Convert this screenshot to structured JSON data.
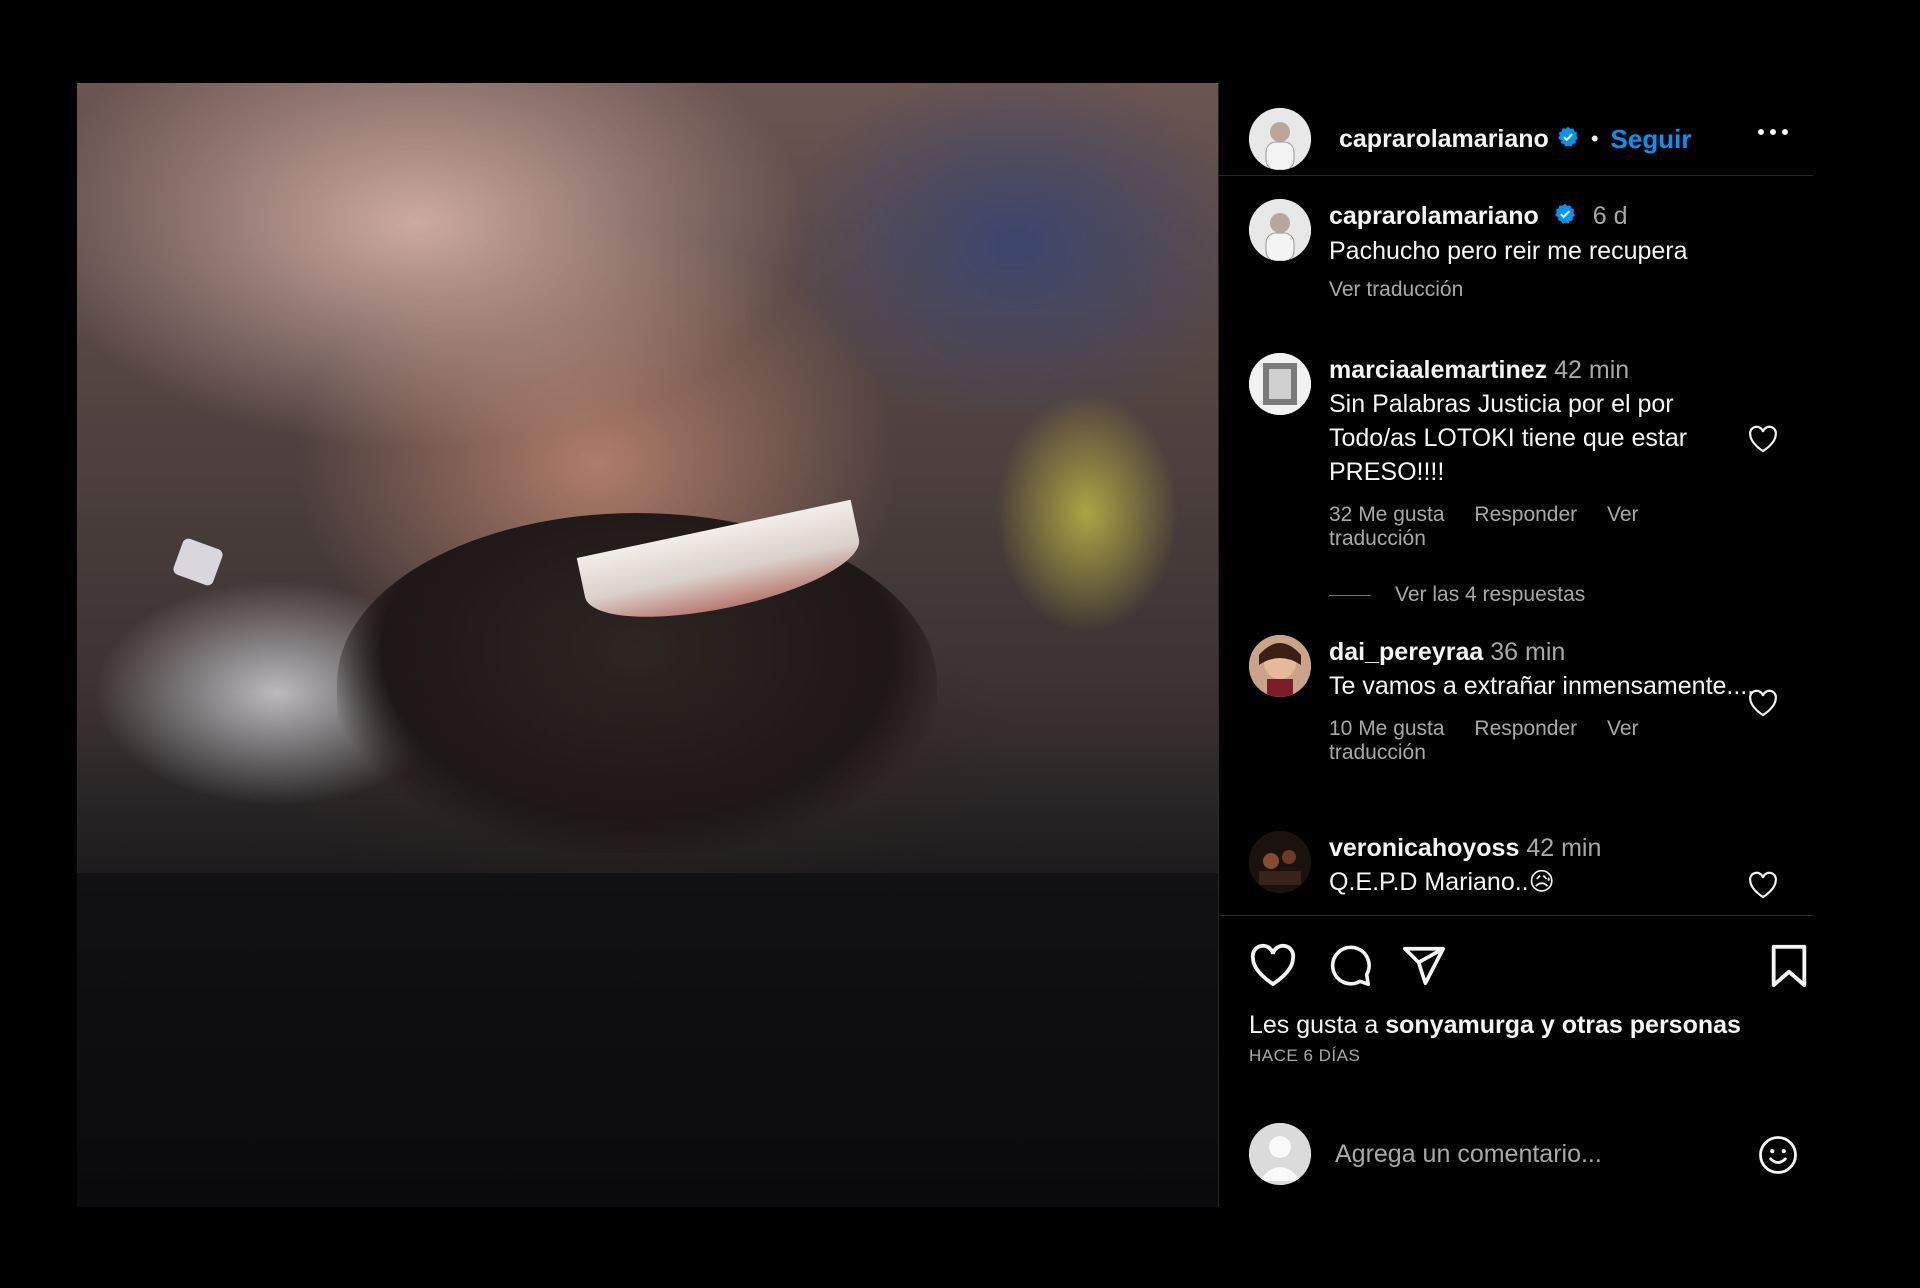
{
  "post": {
    "username": "caprarolamariano",
    "follow_label": "Seguir",
    "dot": "•",
    "caption": {
      "username": "caprarolamariano",
      "time": "6 d",
      "text": "Pachucho pero reir me recupera",
      "translate": "Ver traducción"
    }
  },
  "comments": [
    {
      "username": "marciaalemartinez",
      "time": "42 min",
      "text": "Sin Palabras Justicia por el por Todo/as LOTOKI tiene que estar PRESO!!!!",
      "likes": "32 Me gusta",
      "reply": "Responder",
      "translate": "Ver traducción",
      "replies": "Ver las 4 respuestas"
    },
    {
      "username": "dai_pereyraa",
      "time": "36 min",
      "text": "Te vamos a extrañar inmensamente....",
      "likes": "10 Me gusta",
      "reply": "Responder",
      "translate": "Ver traducción"
    },
    {
      "username": "veronicahoyoss",
      "time": "42 min",
      "text": "Q.E.P.D Mariano..",
      "emoji": "😥"
    }
  ],
  "likes_line": {
    "prefix": "Les gusta a",
    "user": "sonyamurga",
    "suffix": "y otras personas"
  },
  "date": "HACE 6 DÍAS",
  "add_comment": {
    "placeholder": "Agrega un comentario..."
  },
  "icons": {
    "verified": "verified-badge-icon",
    "more": "more-options-icon",
    "like": "heart-icon",
    "comment": "comment-icon",
    "share": "share-icon",
    "save": "bookmark-icon",
    "emoji": "emoji-icon"
  },
  "colors": {
    "accent": "#0095f6",
    "muted": "#a8a8a8",
    "background": "#000000"
  }
}
